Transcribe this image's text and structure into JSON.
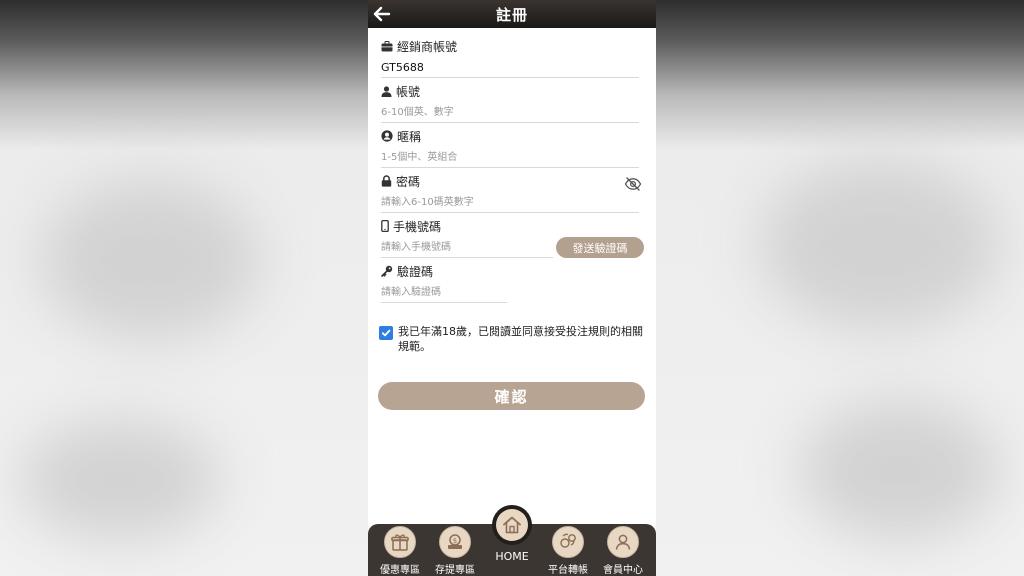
{
  "header": {
    "title": "註冊",
    "back_icon": "arrow-left-icon"
  },
  "form": {
    "agent_account": {
      "label": "經銷商帳號",
      "value": "GT5688",
      "icon": "briefcase-icon"
    },
    "account": {
      "label": "帳號",
      "placeholder": "6-10個英、數字",
      "icon": "user-icon"
    },
    "nickname": {
      "label": "暱稱",
      "placeholder": "1-5個中、英組合",
      "icon": "user-circle-icon"
    },
    "password": {
      "label": "密碼",
      "placeholder": "請輸入6-10碼英數字",
      "icon": "lock-icon",
      "toggle_icon": "eye-off-icon"
    },
    "phone": {
      "label": "手機號碼",
      "placeholder": "請輸入手機號碼",
      "icon": "mobile-icon",
      "send_code_label": "發送驗證碼"
    },
    "code": {
      "label": "驗證碼",
      "placeholder": "請輸入驗證碼",
      "icon": "key-icon"
    }
  },
  "agreement": {
    "checked": true,
    "text": "我已年滿18歲，已閱讀並同意接受投注規則的相關規範。"
  },
  "confirm_label": "確認",
  "nav": {
    "promo": {
      "label": "優惠專區",
      "icon": "gift-icon"
    },
    "deposit": {
      "label": "存提專區",
      "icon": "money-bag-icon"
    },
    "home": {
      "label": "HOME",
      "icon": "house-icon"
    },
    "transfer": {
      "label": "平台轉帳",
      "icon": "transfer-icon"
    },
    "member": {
      "label": "會員中心",
      "icon": "member-icon"
    }
  },
  "colors": {
    "accent": "#b8a493",
    "topbar": "#2a2623",
    "nav_bg": "#3b3632",
    "checkbox": "#2f7de1"
  }
}
